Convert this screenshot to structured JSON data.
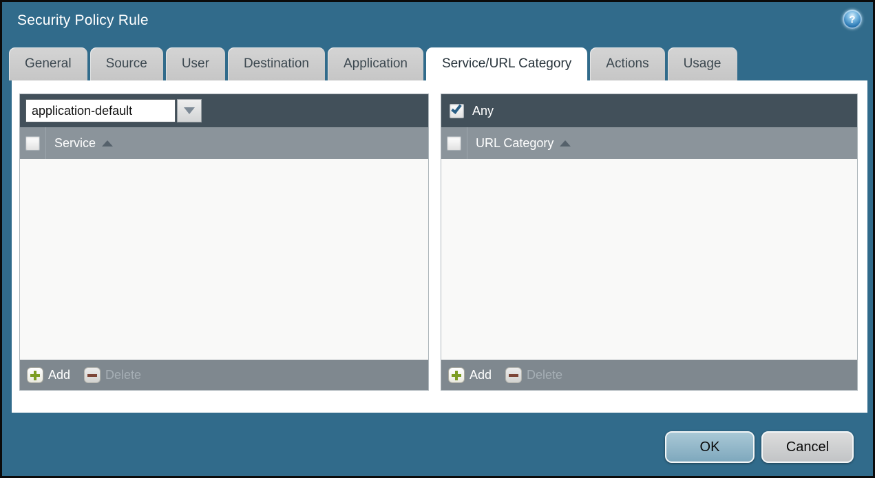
{
  "window": {
    "title": "Security Policy Rule"
  },
  "icons": {
    "help": "question-mark-circle",
    "help_glyph": "?",
    "add": "green-plus",
    "delete": "red-minus",
    "dropdown": "down-triangle",
    "sort": "up-triangle"
  },
  "tabs": [
    {
      "label": "General",
      "active": false
    },
    {
      "label": "Source",
      "active": false
    },
    {
      "label": "User",
      "active": false
    },
    {
      "label": "Destination",
      "active": false
    },
    {
      "label": "Application",
      "active": false
    },
    {
      "label": "Service/URL Category",
      "active": true
    },
    {
      "label": "Actions",
      "active": false
    },
    {
      "label": "Usage",
      "active": false
    }
  ],
  "service_panel": {
    "dropdown_value": "application-default",
    "column_header": "Service",
    "rows": [],
    "add_label": "Add",
    "delete_label": "Delete",
    "delete_enabled": false
  },
  "url_category_panel": {
    "any_label": "Any",
    "any_checked": true,
    "column_header": "URL Category",
    "rows": [],
    "add_label": "Add",
    "delete_label": "Delete",
    "delete_enabled": false
  },
  "dialog_buttons": {
    "ok": "OK",
    "cancel": "Cancel"
  },
  "colors": {
    "background_teal": "#316b8b",
    "panel_header_dark": "#42505a",
    "column_header_gray": "#8b949b",
    "footer_gray": "#7f888f",
    "tab_inactive": "#cacaca",
    "tab_active": "#ffffff",
    "ok_button_blue": "#86afc3",
    "cancel_button_gray": "#c9cbcd",
    "add_plus_green": "#7c9d23",
    "delete_minus_red": "#7d4638",
    "checkmark_blue": "#2a5f86"
  }
}
